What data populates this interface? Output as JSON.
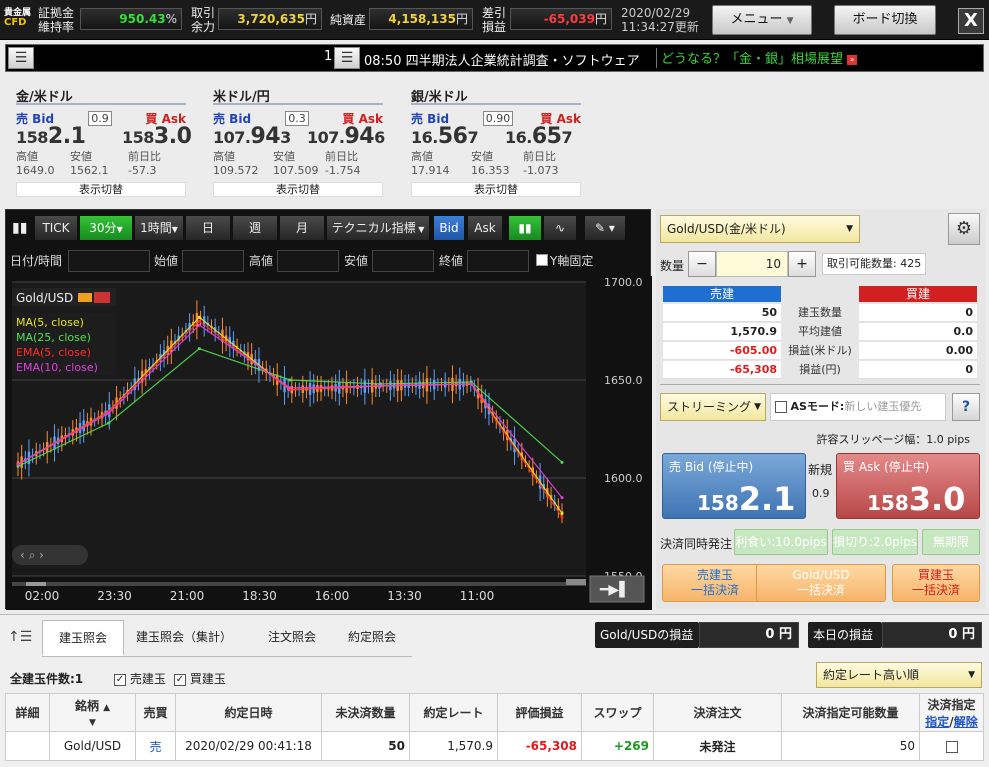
{
  "topbar": {
    "logo_top": "貴金属",
    "logo_bottom": "CFD",
    "margin_label_1": "証拠金",
    "margin_label_2": "維持率",
    "margin_value": "950.43",
    "margin_unit": "%",
    "margin_color": "#34e034",
    "trade_label_1": "取引",
    "trade_label_2": "余力",
    "trade_value": "3,720,635",
    "trade_unit": "円",
    "net_label": "純資産",
    "net_value": "4,158,135",
    "net_unit": "円",
    "diff_label_1": "差引",
    "diff_label_2": "損益",
    "diff_value": "-65,039",
    "diff_unit": "円",
    "diff_color": "#ff3b3b",
    "value_color": "#f0d23a",
    "date": "2020/02/29",
    "time": "11:34:27更新",
    "menu_label": "メニュー",
    "board_label": "ボード切換",
    "close_label": "X"
  },
  "news": {
    "left_number": "1",
    "headline": "08:50 四半期法人企業統計調査・ソフトウェア",
    "ad_text": "どうなる？「金・銀」相場展望",
    "ad_color": "#39d339"
  },
  "quotes": [
    {
      "title": "金/米ドル",
      "bid_label": "売 Bid",
      "ask_label": "買 Ask",
      "spread": "0.9",
      "bid_prefix": "158",
      "bid_big": "2.1",
      "bid_tail": "",
      "ask_prefix": "158",
      "ask_big": "3.0",
      "ask_tail": "",
      "high_label": "高値",
      "low_label": "安値",
      "chg_label": "前日比",
      "high": "1649.0",
      "low": "1562.1",
      "chg": "-57.3",
      "toggle": "表示切替"
    },
    {
      "title": "米ドル/円",
      "bid_label": "売 Bid",
      "ask_label": "買 Ask",
      "spread": "0.3",
      "bid_prefix": "107.",
      "bid_big": "94",
      "bid_tail": "3",
      "ask_prefix": "107.",
      "ask_big": "94",
      "ask_tail": "6",
      "high_label": "高値",
      "low_label": "安値",
      "chg_label": "前日比",
      "high": "109.572",
      "low": "107.509",
      "chg": "-1.754",
      "toggle": "表示切替"
    },
    {
      "title": "銀/米ドル",
      "bid_label": "売 Bid",
      "ask_label": "買 Ask",
      "spread": "0.90",
      "bid_prefix": "16.",
      "bid_big": "56",
      "bid_tail": "7",
      "ask_prefix": "16.",
      "ask_big": "65",
      "ask_tail": "7",
      "high_label": "高値",
      "low_label": "安値",
      "chg_label": "前日比",
      "high": "17.914",
      "low": "16.353",
      "chg": "-1.073",
      "toggle": "表示切替"
    }
  ],
  "chart": {
    "toolbar": {
      "tick": "TICK",
      "m30": "30分",
      "h1": "1時間",
      "day": "日",
      "week": "週",
      "month": "月",
      "tech": "テクニカル指標",
      "bid": "Bid",
      "ask": "Ask"
    },
    "ohlc": {
      "date": "日付/時間",
      "open": "始値",
      "high": "高値",
      "low": "安値",
      "close": "終値",
      "yfix": "Y軸固定"
    },
    "symbol": "Gold/USD",
    "legend": [
      {
        "name": "MA(5, close)",
        "color": "#e6e61e"
      },
      {
        "name": "MA(25, close)",
        "color": "#4fe04f"
      },
      {
        "name": "EMA(5, close)",
        "color": "#ff2a2a"
      },
      {
        "name": "EMA(10, close)",
        "color": "#e040e0"
      }
    ],
    "y_ticks": [
      "1700.0",
      "1650.0",
      "1600.0",
      "1550.0"
    ],
    "x_ticks": [
      "02:00",
      "23:30",
      "21:00",
      "18:30",
      "16:00",
      "13:30",
      "11:00"
    ]
  },
  "chart_data": {
    "type": "line",
    "title": "Gold/USD",
    "ylim": [
      1550,
      1700
    ],
    "x": [
      "02:00",
      "23:30",
      "21:00",
      "18:30",
      "16:00",
      "13:30",
      "11:00"
    ],
    "series": [
      {
        "name": "MA(5, close)",
        "values": [
          1607,
          1634,
          1682,
          1645,
          1647,
          1648,
          1582
        ]
      },
      {
        "name": "MA(25, close)",
        "values": [
          1606,
          1628,
          1666,
          1650,
          1648,
          1649,
          1608
        ]
      },
      {
        "name": "EMA(5, close)",
        "values": [
          1607,
          1634,
          1680,
          1645,
          1647,
          1648,
          1580
        ]
      },
      {
        "name": "EMA(10, close)",
        "values": [
          1607,
          1633,
          1678,
          1646,
          1647,
          1648,
          1590
        ]
      }
    ]
  },
  "order": {
    "symbol_select": "Gold/USD(金/米ドル)",
    "qty_label": "数量",
    "qty_value": "10",
    "qty_minus": "−",
    "qty_plus": "+",
    "tradable": "取引可能数量: 425",
    "sell_header": "売建",
    "buy_header": "買建",
    "rows": [
      {
        "label": "建玉数量",
        "sell": "50",
        "buy": "0",
        "sell_color": "#222"
      },
      {
        "label": "平均建値",
        "sell": "1,570.9",
        "buy": "0.0",
        "sell_color": "#222"
      },
      {
        "label": "損益(米ドル)",
        "sell": "-605.00",
        "buy": "0.00",
        "sell_color": "#e01b1b"
      },
      {
        "label": "損益(円)",
        "sell": "-65,308",
        "buy": "0",
        "sell_color": "#e01b1b"
      }
    ],
    "mode_select": "ストリーミング",
    "as_label": "ASモード:",
    "as_placeholder": "新しい建玉優先",
    "help": "?",
    "slippage": "許容スリッページ幅：1.0 pips",
    "bid_label": "売 Bid (停止中)",
    "bid_prefix": "158",
    "bid_big": "2.1",
    "new_label": "新規",
    "spread": "0.9",
    "ask_label": "買 Ask (停止中)",
    "ask_prefix": "158",
    "ask_big": "3.0",
    "settle_label": "決済同時発注",
    "profit_btn": "利食い:10.0pips",
    "loss_btn": "損切り:2.0pips",
    "unlimited_btn": "無期限",
    "settle_sell_1": "売建玉",
    "settle_sell_2": "一括決済",
    "settle_all_1": "Gold/USD",
    "settle_all_2": "一括決済",
    "settle_buy_1": "買建玉",
    "settle_buy_2": "一括決済"
  },
  "bottom": {
    "tabs": [
      "建玉照会",
      "建玉照会（集計）",
      "注文照会",
      "約定照会"
    ],
    "gold_pl_label": "Gold/USDの損益",
    "gold_pl_value": "0 円",
    "today_pl_label": "本日の損益",
    "today_pl_value": "0 円",
    "count_label": "全建玉件数:1",
    "filter_sell": "売建玉",
    "filter_buy": "買建玉",
    "sort_select": "約定レート高い順",
    "headers": [
      "詳細",
      "銘柄",
      "売買",
      "約定日時",
      "未決済数量",
      "約定レート",
      "評価損益",
      "スワップ",
      "決済注文",
      "決済指定可能数量",
      "決済指定"
    ],
    "header_link_a": "指定",
    "header_link_b": "解除",
    "row": {
      "detail": "",
      "symbol": "Gold/USD",
      "side": "売",
      "datetime": "2020/02/29 00:41:18",
      "qty": "50",
      "rate": "1,570.9",
      "pl": "-65,308",
      "swap": "+269",
      "order": "未発注",
      "settle_qty": "50"
    }
  }
}
